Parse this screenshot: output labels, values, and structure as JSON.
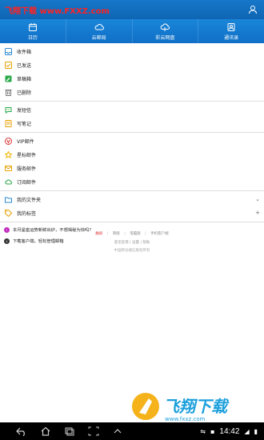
{
  "header": {
    "site_label": "飞翔下载 www.FXXZ.com"
  },
  "tabs": [
    {
      "label": "日历",
      "icon": "calendar-icon"
    },
    {
      "label": "云邮局",
      "icon": "cloud-mail-icon"
    },
    {
      "label": "彩云网盘",
      "icon": "cloud-drive-icon"
    },
    {
      "label": "通讯录",
      "icon": "contacts-icon"
    }
  ],
  "folders": [
    {
      "label": "收件箱",
      "icon": "inbox-icon",
      "color": "#2a8ad6"
    },
    {
      "label": "已发送",
      "icon": "sent-icon",
      "color": "#e8a000"
    },
    {
      "label": "草稿箱",
      "icon": "drafts-icon",
      "color": "#2aa84a"
    },
    {
      "label": "已删除",
      "icon": "trash-icon",
      "color": "#777777"
    }
  ],
  "compose": [
    {
      "label": "发短信",
      "icon": "sms-icon",
      "color": "#2aa84a"
    },
    {
      "label": "写笔记",
      "icon": "note-icon",
      "color": "#e8a000"
    }
  ],
  "special": [
    {
      "label": "VIP邮件",
      "icon": "vip-icon",
      "color": "#d33333"
    },
    {
      "label": "星标邮件",
      "icon": "star-icon",
      "color": "#f0b400"
    },
    {
      "label": "服务邮件",
      "icon": "service-icon",
      "color": "#e8a000"
    },
    {
      "label": "订阅邮件",
      "icon": "subscribe-icon",
      "color": "#2aa84a"
    }
  ],
  "expandables": [
    {
      "label": "我的文件夹",
      "icon": "folder-icon",
      "color": "#2a8ad6",
      "action": "chevron-down-icon"
    },
    {
      "label": "我的标签",
      "icon": "tag-icon",
      "color": "#e8a000",
      "action": "plus-icon"
    }
  ],
  "notices": [
    {
      "text": "本月星座运势新鲜出炉，不想揭秘为快吗？",
      "icon": "info-icon",
      "color": "#c22abf"
    },
    {
      "text": "下载客户端，轻松管理邮箱",
      "icon": "download-icon",
      "color": "#333333"
    }
  ],
  "footer": {
    "row1": [
      "触屏",
      "简版",
      "电脑版",
      "手机客户端"
    ],
    "row2": [
      "意见反馈",
      "设置",
      "帮助"
    ],
    "row3": "中国移动通信版权所有"
  },
  "navbar": {
    "time": "14:42"
  },
  "colors": {
    "header_bg": "#0f6fc6",
    "accent_red": "#ff2222"
  }
}
